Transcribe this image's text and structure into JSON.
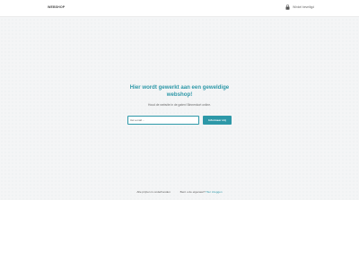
{
  "header": {
    "brand": "WEBSHOP",
    "right_label": "Winkel beveiligd"
  },
  "hero": {
    "headline": "Hier wordt gewerkt aan een geweldige webshop!",
    "subline": "Houd de website in de gaten! Binnenkort online."
  },
  "form": {
    "email_placeholder": "Uw e-mail ...",
    "button_label": "Informeer mij"
  },
  "footer": {
    "left_text": "Alle prijzen in onderhanden",
    "right_text": "Bent u de eigenaar?",
    "login_link": "Hier inloggen"
  },
  "colors": {
    "accent": "#2d98a8",
    "background": "#f4f5f6"
  },
  "icons": {
    "top_right": "lock-icon"
  }
}
